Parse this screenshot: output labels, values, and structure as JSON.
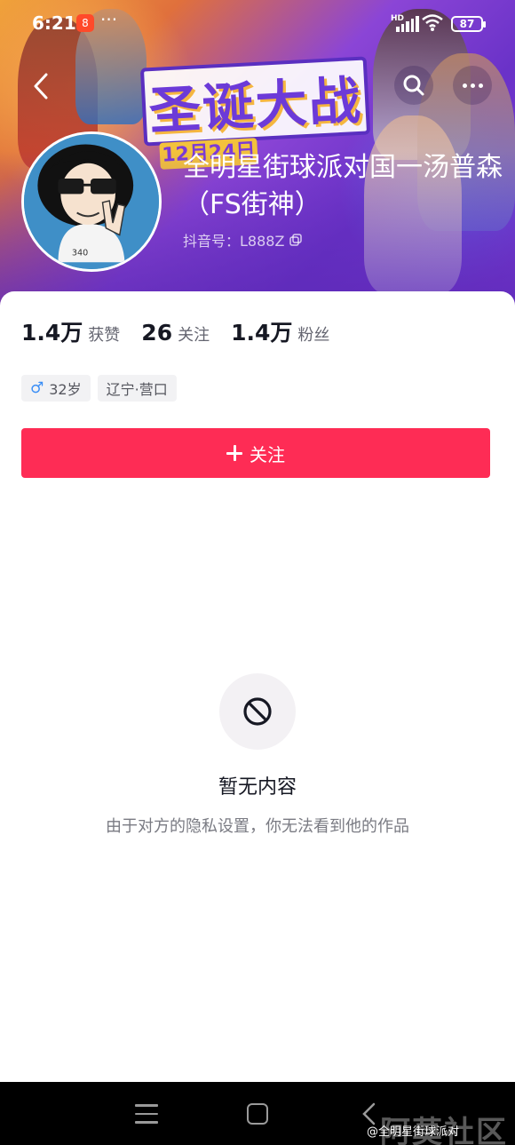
{
  "status_bar": {
    "time": "6:21",
    "app_icon_text": "8",
    "more": "···",
    "network": "HD",
    "battery": "87"
  },
  "banner": {
    "title_art": "圣诞大战",
    "date_art": "12月24日"
  },
  "profile": {
    "nickname": "全明星街球派对国一汤普森（FS街神）",
    "douyin_id": "抖音号：L888Z"
  },
  "stats": [
    {
      "value": "1.4万",
      "label": "获赞"
    },
    {
      "value": "26",
      "label": "关注"
    },
    {
      "value": "1.4万",
      "label": "粉丝"
    }
  ],
  "tags": {
    "gender_age": "32岁",
    "location": "辽宁·营口"
  },
  "follow_button": "关注",
  "empty_state": {
    "title": "暂无内容",
    "description": "由于对方的隐私设置，你无法看到他的作品"
  },
  "watermark": {
    "big": "阿莫社区",
    "small": "@全明星街球派对"
  },
  "colors": {
    "accent": "#fe2c55",
    "gender": "#3a8ef6"
  },
  "icons": [
    "back-icon",
    "search-icon",
    "more-icon",
    "copy-icon",
    "male-icon",
    "plus-icon",
    "blocked-icon",
    "menu-icon",
    "home-icon",
    "nav-back-icon"
  ]
}
